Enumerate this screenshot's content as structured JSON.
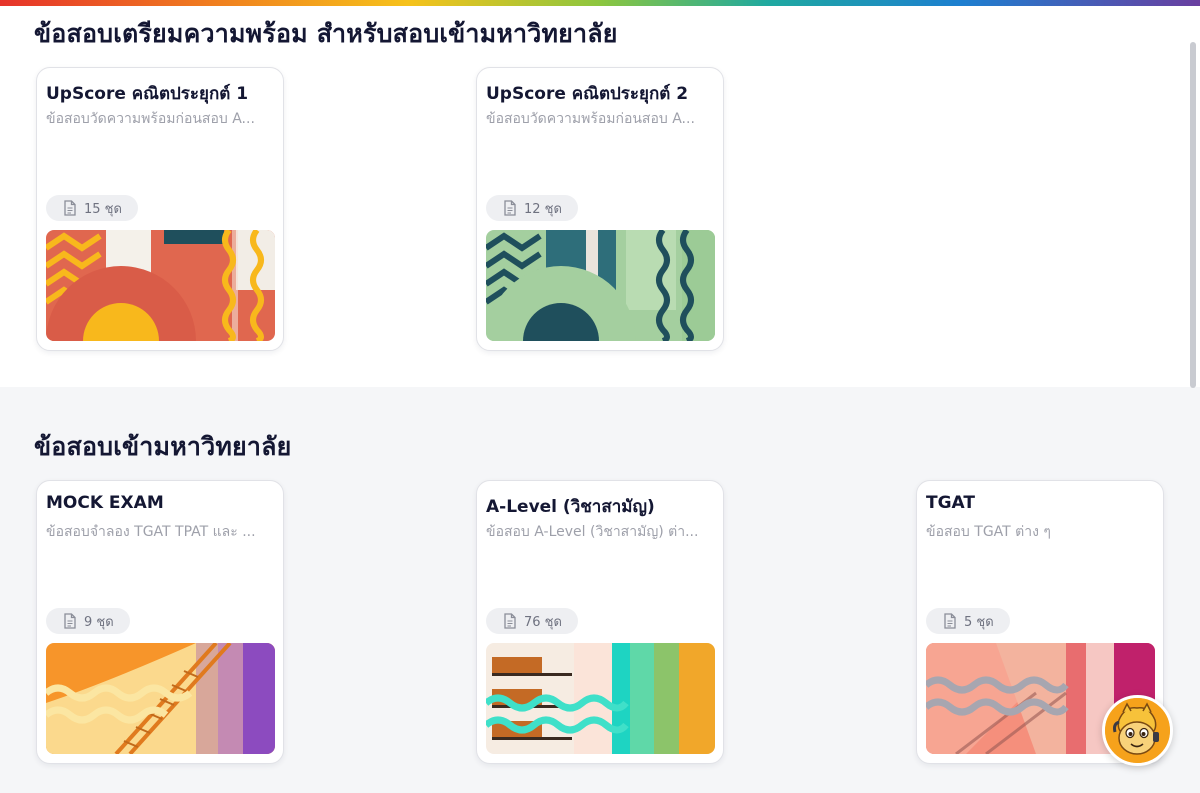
{
  "sections": [
    {
      "title": "ข้อสอบเตรียมความพร้อม สำหรับสอบเข้ามหาวิทยาลัย",
      "cards": [
        {
          "title": "UpScore คณิตประยุกต์ 1",
          "description": "ข้อสอบวัดความพร้อมก่อนสอบ A...",
          "count": "15 ชุด"
        },
        {
          "title": "UpScore คณิตประยุกต์ 2",
          "description": "ข้อสอบวัดความพร้อมก่อนสอบ A...",
          "count": "12 ชุด"
        }
      ]
    },
    {
      "title": "ข้อสอบเข้ามหาวิทยาลัย",
      "cards": [
        {
          "title": "MOCK EXAM",
          "description": "ข้อสอบจำลอง TGAT TPAT และ ...",
          "count": "9 ชุด"
        },
        {
          "title": "A-Level (วิชาสามัญ)",
          "description": "ข้อสอบ A-Level (วิชาสามัญ) ต่า...",
          "count": "76 ชุด"
        },
        {
          "title": "TGAT",
          "description": "ข้อสอบ TGAT ต่าง ๆ",
          "count": "5 ชุด"
        }
      ]
    }
  ],
  "icons": {
    "count_icon": "document-icon",
    "chat_widget": "mascot-chat-icon"
  },
  "colors": {
    "accent_red": "#e6332a",
    "text_dark": "#141733",
    "text_muted": "#9ea0aa",
    "card_theme_1": [
      "#e0674f",
      "#f8b81c"
    ],
    "card_theme_2": [
      "#a4cf9f",
      "#1f4f5c"
    ],
    "card_theme_3": [
      "#f7952a",
      "#8c4bbf"
    ],
    "card_theme_4": [
      "#1ed4c2",
      "#f1a72a"
    ],
    "card_theme_5": [
      "#f58f7c",
      "#c0216b"
    ]
  }
}
